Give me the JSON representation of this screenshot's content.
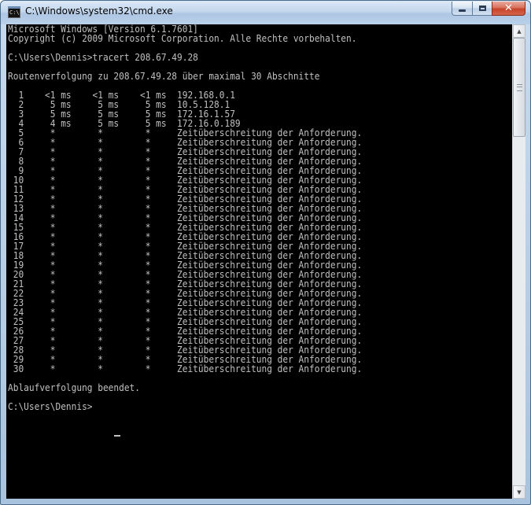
{
  "window": {
    "title": "C:\\Windows\\system32\\cmd.exe",
    "app_icon_text": "C:\\"
  },
  "caption_buttons": {
    "minimize_icon": "minimize-icon",
    "maximize_icon": "maximize-icon",
    "close_glyph": "✕"
  },
  "scrollbar": {
    "up_glyph": "▲",
    "down_glyph": "▼"
  },
  "console": {
    "lines": [
      "Microsoft Windows [Version 6.1.7601]",
      "Copyright (c) 2009 Microsoft Corporation. Alle Rechte vorbehalten.",
      "",
      "C:\\Users\\Dennis>tracert 208.67.49.28",
      "",
      "Routenverfolgung zu 208.67.49.28 über maximal 30 Abschnitte",
      "",
      "  1    <1 ms    <1 ms    <1 ms  192.168.0.1",
      "  2     5 ms     5 ms     5 ms  10.5.128.1",
      "  3     5 ms     5 ms     5 ms  172.16.1.57",
      "  4     4 ms     5 ms     5 ms  172.16.0.189",
      "  5     *        *        *     Zeitüberschreitung der Anforderung.",
      "  6     *        *        *     Zeitüberschreitung der Anforderung.",
      "  7     *        *        *     Zeitüberschreitung der Anforderung.",
      "  8     *        *        *     Zeitüberschreitung der Anforderung.",
      "  9     *        *        *     Zeitüberschreitung der Anforderung.",
      " 10     *        *        *     Zeitüberschreitung der Anforderung.",
      " 11     *        *        *     Zeitüberschreitung der Anforderung.",
      " 12     *        *        *     Zeitüberschreitung der Anforderung.",
      " 13     *        *        *     Zeitüberschreitung der Anforderung.",
      " 14     *        *        *     Zeitüberschreitung der Anforderung.",
      " 15     *        *        *     Zeitüberschreitung der Anforderung.",
      " 16     *        *        *     Zeitüberschreitung der Anforderung.",
      " 17     *        *        *     Zeitüberschreitung der Anforderung.",
      " 18     *        *        *     Zeitüberschreitung der Anforderung.",
      " 19     *        *        *     Zeitüberschreitung der Anforderung.",
      " 20     *        *        *     Zeitüberschreitung der Anforderung.",
      " 21     *        *        *     Zeitüberschreitung der Anforderung.",
      " 22     *        *        *     Zeitüberschreitung der Anforderung.",
      " 23     *        *        *     Zeitüberschreitung der Anforderung.",
      " 24     *        *        *     Zeitüberschreitung der Anforderung.",
      " 25     *        *        *     Zeitüberschreitung der Anforderung.",
      " 26     *        *        *     Zeitüberschreitung der Anforderung.",
      " 27     *        *        *     Zeitüberschreitung der Anforderung.",
      " 28     *        *        *     Zeitüberschreitung der Anforderung.",
      " 29     *        *        *     Zeitüberschreitung der Anforderung.",
      " 30     *        *        *     Zeitüberschreitung der Anforderung.",
      "",
      "Ablaufverfolgung beendet.",
      "",
      "C:\\Users\\Dennis>"
    ]
  },
  "colors": {
    "console_background": "#000000",
    "console_text": "#c0c0c0",
    "close_button": "#c7432b"
  }
}
